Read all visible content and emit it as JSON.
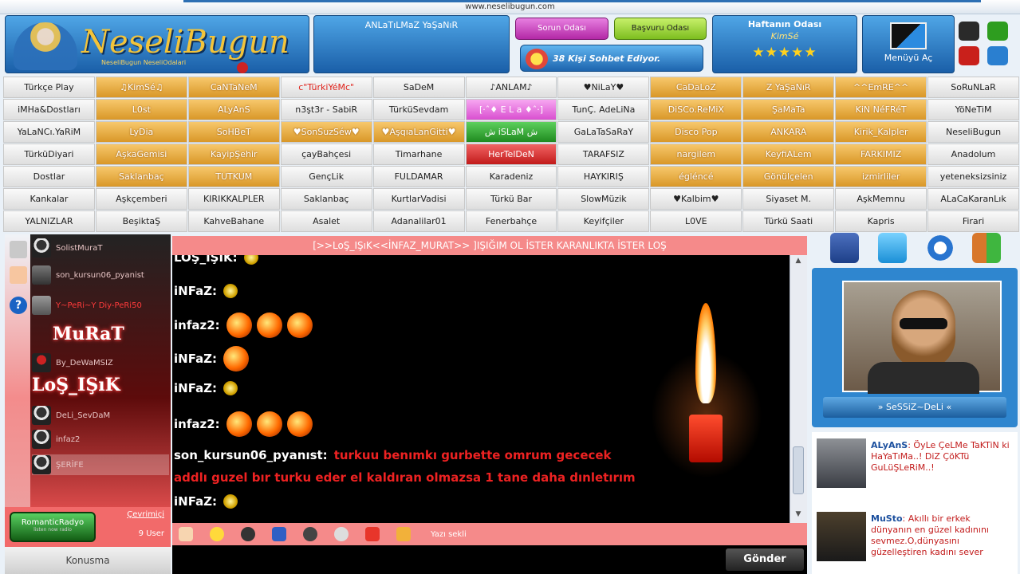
{
  "header": {
    "url": "www.neselibugun.com",
    "logo_text": "NeseliBugun",
    "logo_sub": "NeseliBugun NeseliOdalari",
    "center_title": "ANLaTıLMaZ YaŞaNıR",
    "sorun_label": "Sorun Odası",
    "basvuru_label": "Başvuru Odası",
    "count_text": "38 Kişi Sohbet Ediyor.",
    "haftanin_title": "Haftanın Odası",
    "haftanin_room": "KimSé",
    "stars": "★★★★★",
    "menu_label": "Menüyü Aç"
  },
  "theme_colors": [
    "#2a2a2a",
    "#2e9d1f",
    "#c9201b",
    "#2a7fd0"
  ],
  "rooms": [
    [
      "Türkçe Play",
      "♫KimSé♫",
      "CaNTaNeM",
      "c\"TürkiYéMc\"",
      "SaDeM",
      "♪ANLAM♪",
      "♥NiLaY♥",
      "CaDaLoZ",
      "Z YaŞaNıR",
      "^^EmRE^^",
      "SoRuNLaR"
    ],
    [
      "iMHa&Dostları",
      "L0st",
      "ALyAnS",
      "n3şt3r - SabiR",
      "TürküSevdam",
      "[·ˆ♦ E L a ♦ˆ·]",
      "TunÇ. AdeLiNa",
      "DiSCo.ReMiX",
      "ŞaMaTa",
      "KiN NéFRéT",
      "YöNeTiM"
    ],
    [
      "YaLaNCı.YaRiM",
      "LyDia",
      "SoHBeT",
      "♥SonSuzSéw♥",
      "♥AşqıaLanGitti♥",
      "ش iSLaM ش",
      "GaLaTaSaRaY",
      "Disco Pop",
      "ANKARA",
      "Kirik_Kalpler",
      "NeseliBugun"
    ],
    [
      "TürküDiyari",
      "AşkaGemisi",
      "KayipŞehir",
      "çayBahçesi",
      "Timarhane",
      "HerTelDeN",
      "TARAFSIZ",
      "nargilem",
      "KeyfiALem",
      "FARKIMIZ",
      "Anadolum"
    ],
    [
      "Dostlar",
      "Saklanbaç",
      "TUTKUM",
      "GençLik",
      "FULDAMAR",
      "Karadeniz",
      "HAYKIRIŞ",
      "égléncé",
      "Gönülçelen",
      "izmirliler",
      "yeteneksizsiniz"
    ],
    [
      "Kankalar",
      "Aşkçemberi",
      "KIRIKKALPLER",
      "Saklanbaç",
      "KurtlarVadisi",
      "Türkü Bar",
      "SlowMüzik",
      "♥Kalbim♥",
      "Siyaset M.",
      "AşkMemnu",
      "ALaCaKaranLık"
    ],
    [
      "YALNIZLAR",
      "BeşiktaŞ",
      "KahveBahane",
      "Asalet",
      "Adanalilar01",
      "Fenerbahçe",
      "Keyifçiler",
      "L0VE",
      "Türkü Saati",
      "Kapris",
      "Firari"
    ]
  ],
  "users": [
    {
      "name": "SolistMuraT"
    },
    {
      "name": "son_kursun06_pyanist"
    },
    {
      "name": "Y~PeRi~Y Diy-PeRi50"
    },
    {
      "name": "By_DeWaMSIZ"
    },
    {
      "name": "DeLi_SevDaM"
    },
    {
      "name": "infaz2"
    },
    {
      "name": "ŞERİFE"
    }
  ],
  "big_names": {
    "murat": "MuRaT",
    "los": "LoŞ_IŞıK"
  },
  "left_panel": {
    "radio": "RomanticRadyo",
    "radio_sub": "listen now radio",
    "cevrimici": "Çevrimiçi",
    "user_count": "9 User",
    "konusma": "Konusma"
  },
  "chat": {
    "title": "[>>LoŞ_IŞıK<<İNFAZ_MURAT>> ]IŞIĞIM OL İSTER KARANLIKTA İSTER LOŞ",
    "messages": [
      {
        "nick": "LOŞ_IŞIK:",
        "text": ""
      },
      {
        "nick": "iNFaZ:",
        "text": ""
      },
      {
        "nick": "infaz2:",
        "text": ""
      },
      {
        "nick": "iNFaZ:",
        "text": ""
      },
      {
        "nick": "iNFaZ:",
        "text": ""
      },
      {
        "nick": "infaz2:",
        "text": ""
      },
      {
        "nick": "son_kursun06_pyanıst:",
        "text": "turkuu benımkı gurbette omrum gececek"
      },
      {
        "nick": "",
        "text": "addlı guzel bır turku eder el kaldıran olmazsa 1 tane daha dınletırım"
      },
      {
        "nick": "iNFaZ:",
        "text": ""
      }
    ],
    "toolbar_label": "Yazı sekli",
    "send_label": "Gönder"
  },
  "profile": {
    "name": "» SeSSiZ~DeLi «"
  },
  "feed": [
    {
      "name": "ALyAnS",
      "text": ": ÖyLe ÇeLMe TaKTiN ki HaYaTıMa..! DiZ ÇöKTü GuLüŞLeRiM..!"
    },
    {
      "name": "MuSto",
      "text": ": Akıllı bir erkek dünyanın en güzel kadınını sevmez.O,dünyasını güzelleştiren kadını sever"
    }
  ]
}
